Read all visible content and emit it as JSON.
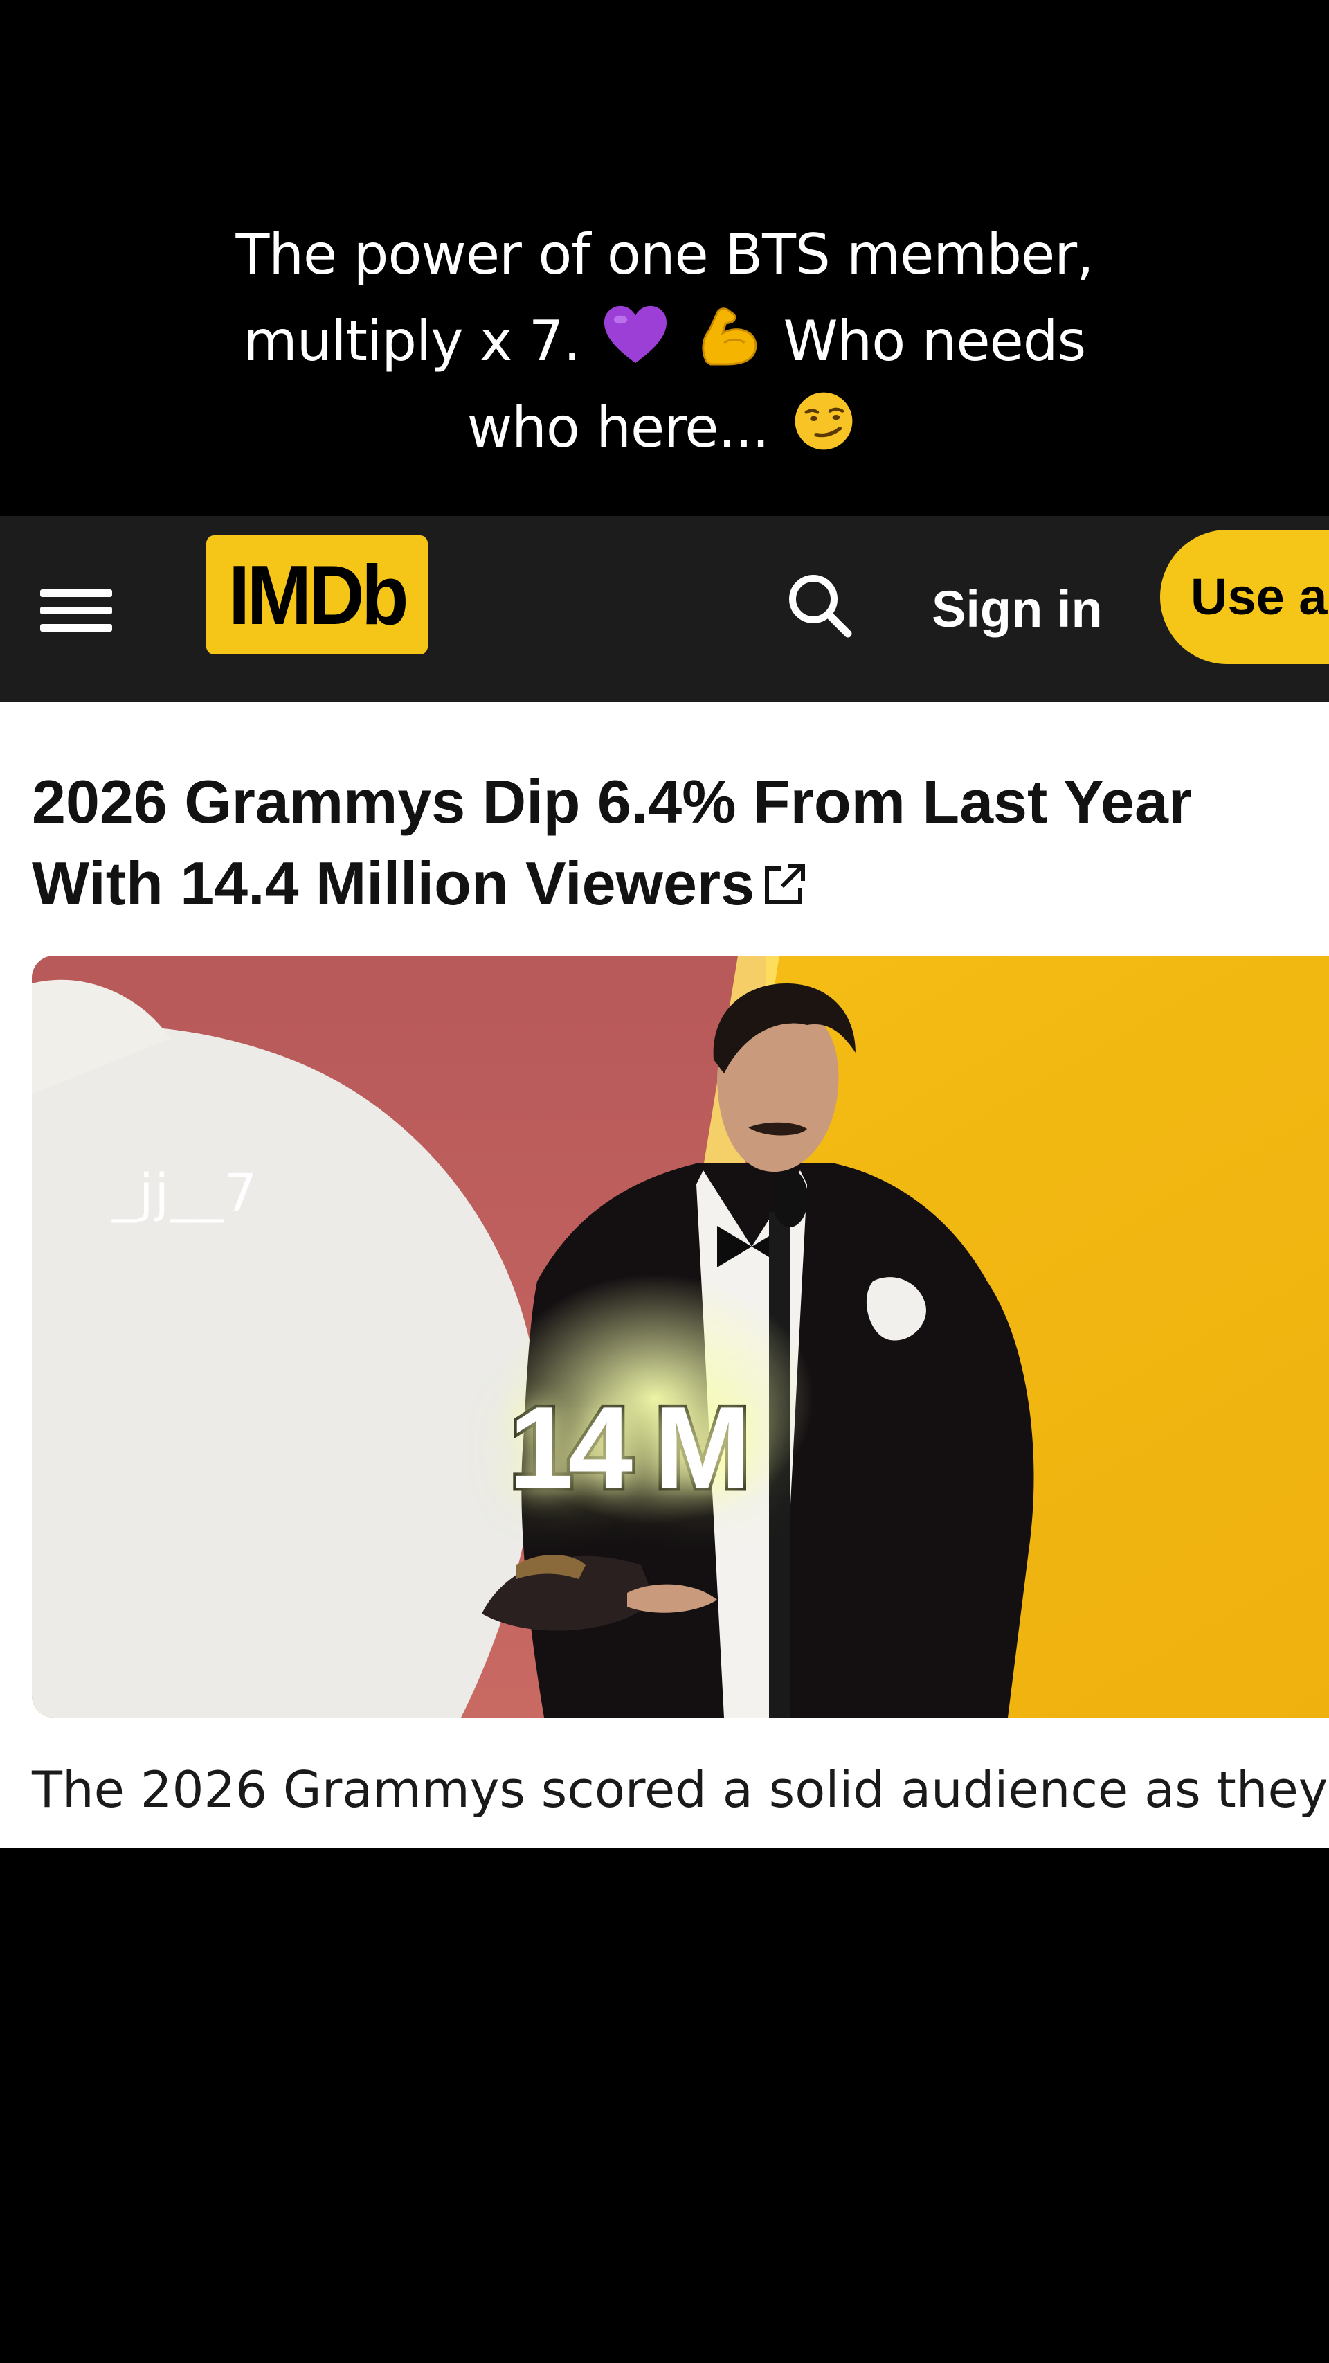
{
  "caption": {
    "line1": "The power of one BTS member,",
    "line2_before": "multiply x 7.",
    "line2_after": "Who needs",
    "line3": "who here...",
    "emojis": [
      "purple-heart-icon",
      "flexed-biceps-icon",
      "smirking-face-icon"
    ]
  },
  "header": {
    "logo_text": "IMDb",
    "sign_in_label": "Sign in",
    "use_app_label": "Use app",
    "brand_color": "#f5c518",
    "bar_color": "#1c1c1c"
  },
  "article": {
    "headline": "2026 Grammys Dip 6.4% From Last Year With 14.4 Million Viewers",
    "image_watermark": "_jj__7",
    "image_overlay_text": "14 M",
    "teaser_text": "The 2026 Grammys scored a solid audience as they"
  }
}
